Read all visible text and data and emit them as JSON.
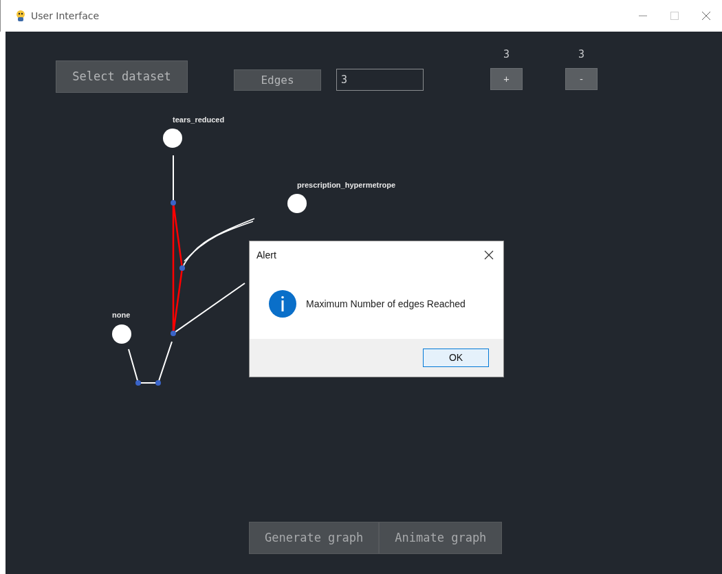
{
  "window": {
    "title": "User Interface"
  },
  "toolbar": {
    "select_dataset": "Select dataset",
    "edges_label": "Edges",
    "edges_field": {
      "value": "3"
    },
    "counters": [
      {
        "count": "3",
        "button": "+"
      },
      {
        "count": "3",
        "button": "-"
      }
    ]
  },
  "graph": {
    "nodes": [
      {
        "label": "tears_reduced"
      },
      {
        "label": "prescription_hypermetrope"
      },
      {
        "label": "none"
      }
    ]
  },
  "actions": [
    "Generate graph",
    "Animate graph"
  ],
  "alert": {
    "title": "Alert",
    "message": "Maximum Number of edges Reached",
    "button": "OK"
  }
}
